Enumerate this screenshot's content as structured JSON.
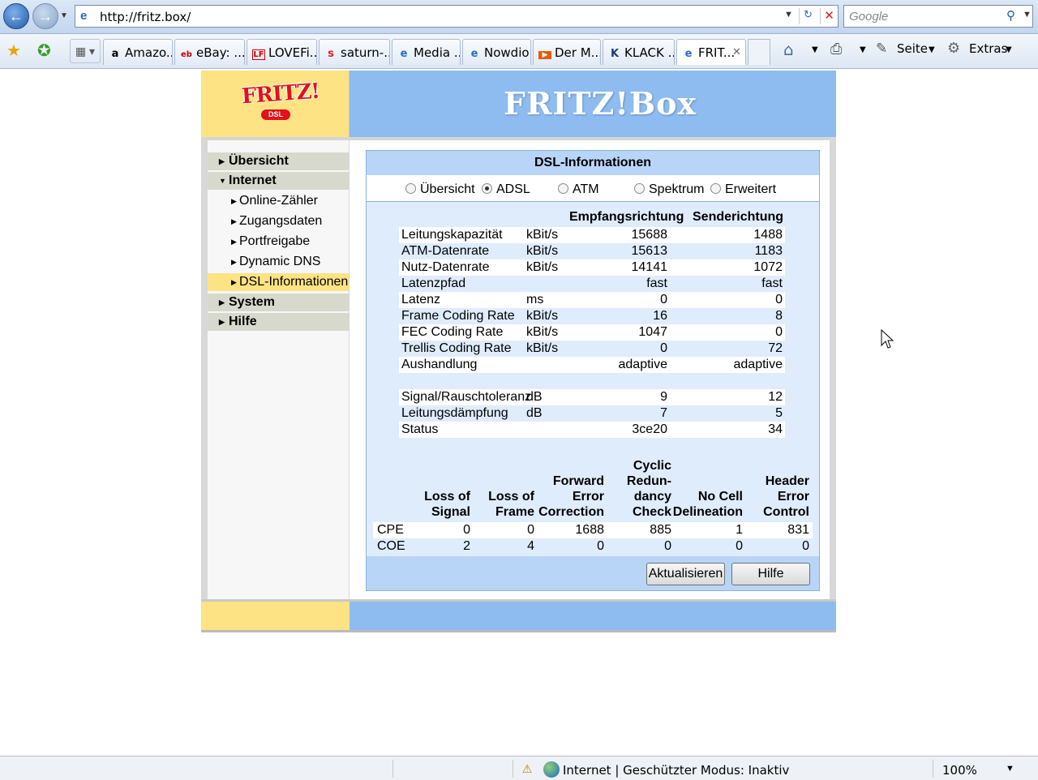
{
  "browser": {
    "url": "http://fritz.box/",
    "search_placeholder": "Google",
    "tabs": [
      {
        "label": "Amazo...",
        "icon": "a"
      },
      {
        "label": "eBay: ...",
        "icon": "eb"
      },
      {
        "label": "LOVEFi...",
        "icon": "LF"
      },
      {
        "label": "saturn-...",
        "icon": "s"
      },
      {
        "label": "Media ...",
        "icon": "e"
      },
      {
        "label": "Nowdio",
        "icon": "e"
      },
      {
        "label": "Der M...",
        "icon": "▶"
      },
      {
        "label": "KLACK ...",
        "icon": "K"
      },
      {
        "label": "FRIT...",
        "icon": "e"
      }
    ],
    "commands": {
      "page": "Seite",
      "extras": "Extras"
    },
    "status_text": "Internet | Geschützter Modus: Inaktiv",
    "zoom": "100%"
  },
  "fritz": {
    "logo_text": "FRITZ!",
    "logo_sub": "DSL",
    "brand": "FRITZ!Box",
    "menu": {
      "overview": "Übersicht",
      "internet": "Internet",
      "online_counter": "Online-Zähler",
      "access_data": "Zugangsdaten",
      "port_forwarding": "Portfreigabe",
      "dynamic_dns": "Dynamic DNS",
      "dsl_info": "DSL-Informationen",
      "system": "System",
      "help": "Hilfe"
    },
    "panel": {
      "title": "DSL-Informationen",
      "views": [
        "Übersicht",
        "ADSL",
        "ATM",
        "Spektrum",
        "Erweitert"
      ],
      "selected_view": "ADSL",
      "col_down": "Empfangsrichtung",
      "col_up": "Senderichtung",
      "rows": [
        {
          "label": "Leitungskapazität",
          "unit": "kBit/s",
          "down": "15688",
          "up": "1488"
        },
        {
          "label": "ATM-Datenrate",
          "unit": "kBit/s",
          "down": "15613",
          "up": "1183"
        },
        {
          "label": "Nutz-Datenrate",
          "unit": "kBit/s",
          "down": "14141",
          "up": "1072"
        },
        {
          "label": "Latenzpfad",
          "unit": "",
          "down": "fast",
          "up": "fast"
        },
        {
          "label": "Latenz",
          "unit": "ms",
          "down": "0",
          "up": "0"
        },
        {
          "label": "Frame Coding Rate",
          "unit": "kBit/s",
          "down": "16",
          "up": "8"
        },
        {
          "label": "FEC Coding Rate",
          "unit": "kBit/s",
          "down": "1047",
          "up": "0"
        },
        {
          "label": "Trellis Coding Rate",
          "unit": "kBit/s",
          "down": "0",
          "up": "72"
        },
        {
          "label": "Aushandlung",
          "unit": "",
          "down": "adaptive",
          "up": "adaptive"
        }
      ],
      "rows2": [
        {
          "label": "Signal/Rauschtoleranz",
          "unit": "dB",
          "down": "9",
          "up": "12"
        },
        {
          "label": "Leitungsdämpfung",
          "unit": "dB",
          "down": "7",
          "up": "5"
        },
        {
          "label": "Status",
          "unit": "",
          "down": "3ce20",
          "up": "34"
        }
      ],
      "err_headers": [
        [
          "Loss of",
          "Signal"
        ],
        [
          "Loss of",
          "Frame"
        ],
        [
          "Forward",
          "Error",
          "Correction"
        ],
        [
          "Cyclic",
          "Redun-",
          "dancy",
          "Check"
        ],
        [
          "No Cell",
          "Delineation"
        ],
        [
          "Header",
          "Error",
          "Control"
        ]
      ],
      "err_rows": [
        {
          "label": "CPE",
          "values": [
            "0",
            "0",
            "1688",
            "885",
            "1",
            "831"
          ]
        },
        {
          "label": "COE",
          "values": [
            "2",
            "4",
            "0",
            "0",
            "0",
            "0"
          ]
        }
      ],
      "refresh_label": "Aktualisieren",
      "help_label": "Hilfe"
    }
  }
}
